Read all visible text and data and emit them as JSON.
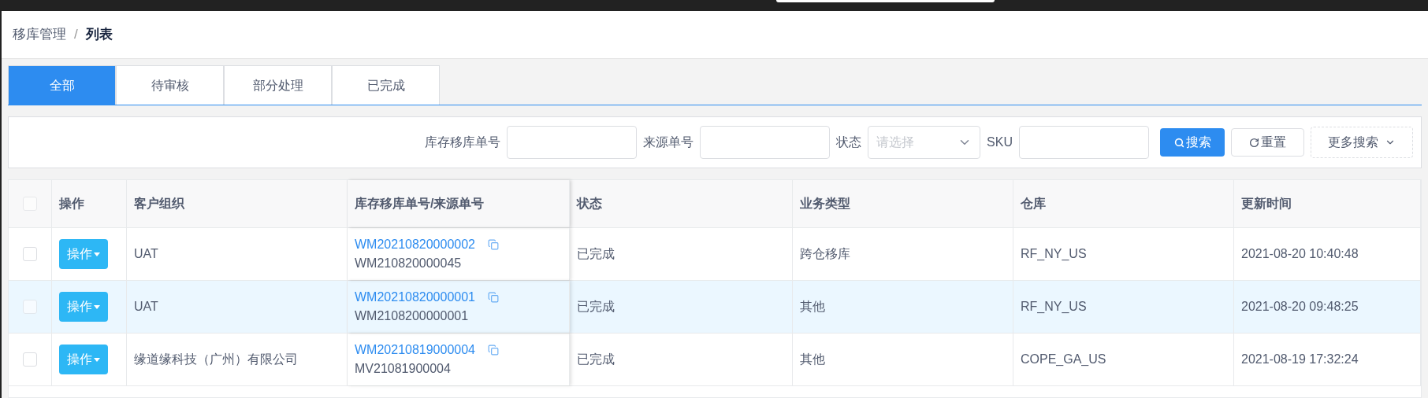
{
  "breadcrumb": {
    "parent": "移库管理",
    "separator": "/",
    "current": "列表"
  },
  "tabs": [
    {
      "label": "全部",
      "selected": true
    },
    {
      "label": "待审核",
      "selected": false
    },
    {
      "label": "部分处理",
      "selected": false
    },
    {
      "label": "已完成",
      "selected": false
    }
  ],
  "search": {
    "fields": [
      {
        "kind": "text",
        "label": "库存移库单号"
      },
      {
        "kind": "text",
        "label": "来源单号"
      },
      {
        "kind": "select",
        "label": "状态",
        "placeholder": "请选择"
      },
      {
        "kind": "text",
        "label": "SKU"
      }
    ],
    "buttons": [
      {
        "kind": "primary",
        "label": "搜索"
      },
      {
        "kind": "reset",
        "label": "重置"
      },
      {
        "kind": "more",
        "label": "更多搜索"
      }
    ]
  },
  "table": {
    "all_checked": false,
    "columns": [
      "操作",
      "客户组织",
      "库存移库单号/来源单号",
      "状态",
      "业务类型",
      "仓库",
      "更新时间"
    ],
    "rows": [
      {
        "checked": false,
        "hovered": false,
        "action": "操作",
        "org": "UAT",
        "order_no": "WM20210820000002",
        "source_no": "WM210820000045",
        "status": "已完成",
        "type": "跨仓移库",
        "warehouse": "RF_NY_US",
        "updated": "2021-08-20 10:40:48"
      },
      {
        "checked": false,
        "hovered": true,
        "action": "操作",
        "org": "UAT",
        "order_no": "WM20210820000001",
        "source_no": "WM2108200000001",
        "status": "已完成",
        "type": "其他",
        "warehouse": "RF_NY_US",
        "updated": "2021-08-20 09:48:25"
      },
      {
        "checked": false,
        "hovered": false,
        "action": "操作",
        "org": "缘道缘科技（广州）有限公司",
        "order_no": "WM20210819000004",
        "source_no": "MV21081900004",
        "status": "已完成",
        "type": "其他",
        "warehouse": "COPE_GA_US",
        "updated": "2021-08-19 17:32:24"
      }
    ]
  }
}
